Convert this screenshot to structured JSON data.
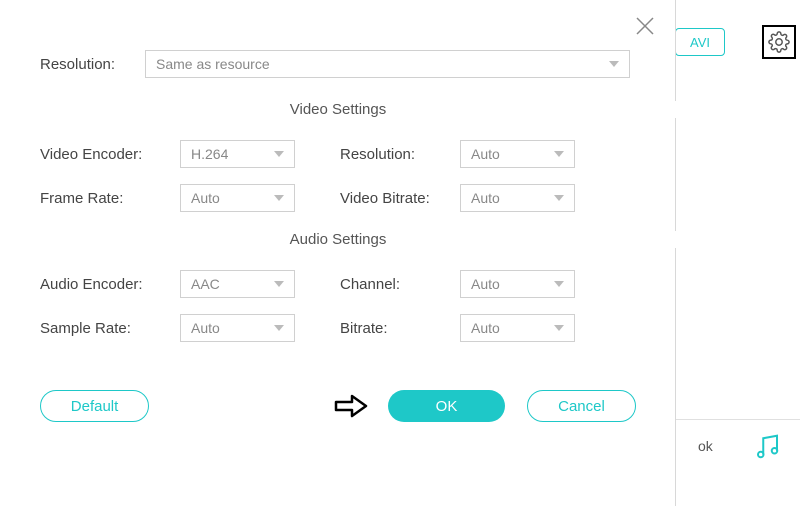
{
  "top": {
    "resolution_label": "Resolution:",
    "resolution_value": "Same as resource"
  },
  "sections": {
    "video_title": "Video Settings",
    "audio_title": "Audio Settings"
  },
  "video": {
    "encoder_label": "Video Encoder:",
    "encoder_value": "H.264",
    "resolution_label": "Resolution:",
    "resolution_value": "Auto",
    "framerate_label": "Frame Rate:",
    "framerate_value": "Auto",
    "bitrate_label": "Video Bitrate:",
    "bitrate_value": "Auto"
  },
  "audio": {
    "encoder_label": "Audio Encoder:",
    "encoder_value": "AAC",
    "channel_label": "Channel:",
    "channel_value": "Auto",
    "samplerate_label": "Sample Rate:",
    "samplerate_value": "Auto",
    "bitrate_label": "Bitrate:",
    "bitrate_value": "Auto"
  },
  "buttons": {
    "default": "Default",
    "ok": "OK",
    "cancel": "Cancel"
  },
  "bg": {
    "avi": "AVI",
    "ok_frag": "ok"
  }
}
